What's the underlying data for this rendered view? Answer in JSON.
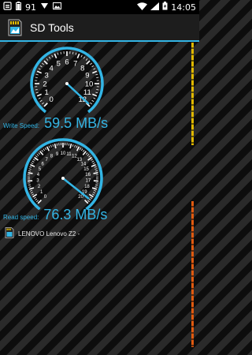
{
  "status_bar": {
    "battery_level": "91",
    "time": "14:05",
    "icons": [
      "notification-icon",
      "battery-icon",
      "download-icon",
      "image-icon",
      "wifi-icon",
      "signal-icon",
      "battery-charging-icon"
    ]
  },
  "app": {
    "title": "SD Tools",
    "icon": "sd-card-icon"
  },
  "write_gauge": {
    "labels": [
      "0",
      "1",
      "2",
      "3",
      "4",
      "5",
      "6",
      "7",
      "8",
      "9",
      "10",
      "11",
      "12"
    ],
    "needle_value": 11.9,
    "max": 12
  },
  "read_gauge": {
    "labels": [
      "0",
      "1",
      "2",
      "3",
      "4",
      "5",
      "6",
      "7",
      "8",
      "9",
      "10",
      "11",
      "12",
      "13",
      "14",
      "15",
      "16",
      "17",
      "18",
      "19",
      "20"
    ],
    "needle_value": 19.5,
    "max": 20
  },
  "write_speed": {
    "label": "Write Speed:",
    "value": "59.5 MB/s"
  },
  "read_speed": {
    "label": "Read speed:",
    "value": "76.3 MB/s"
  },
  "device": {
    "name": "LENOVO Lenovo Z2 -",
    "icon": "sd-card-icon"
  },
  "colors": {
    "accent": "#33b5e5",
    "scroll_top": "#e0b800",
    "scroll_bottom": "#e05a10"
  }
}
